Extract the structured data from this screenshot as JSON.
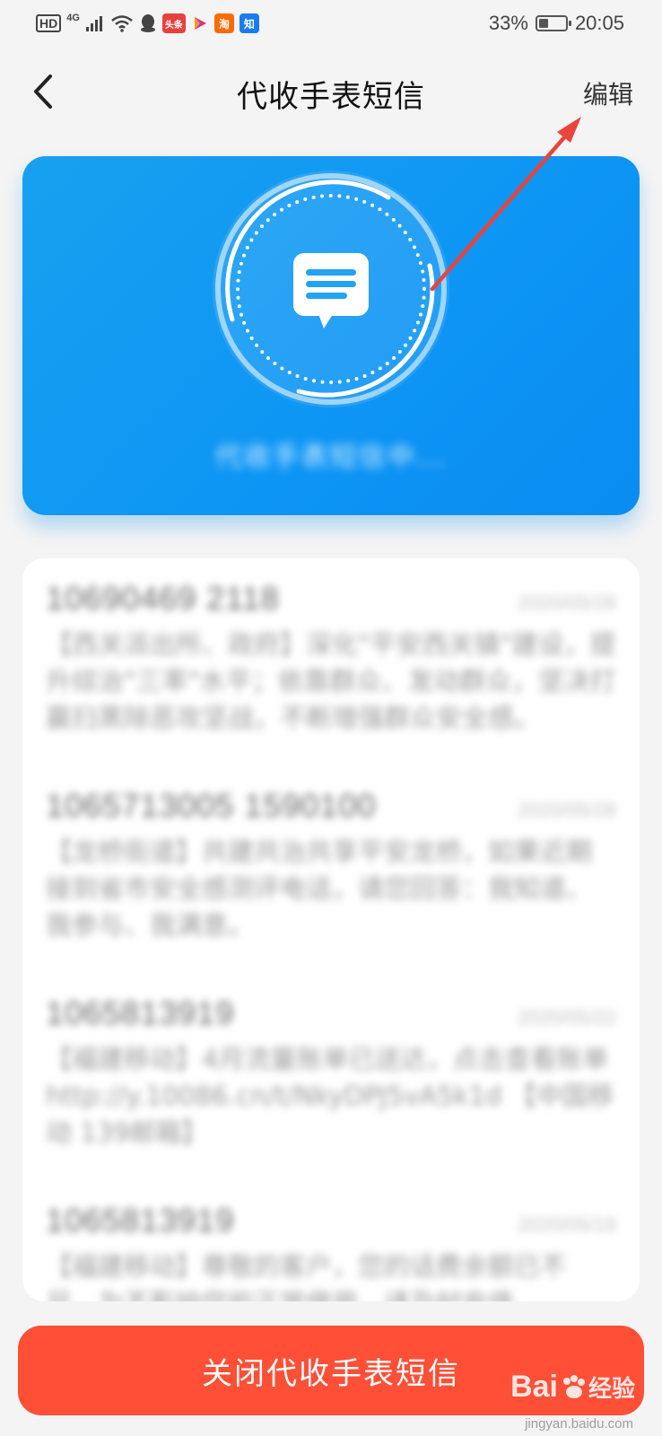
{
  "status_bar": {
    "hd": "HD",
    "network": "4G",
    "app_icons": [
      "头条",
      "淘",
      "知"
    ],
    "battery": "33%",
    "time": "20:05"
  },
  "nav": {
    "title": "代收手表短信",
    "edit_label": "编辑"
  },
  "hero": {
    "status_text": "代收手表短信中..."
  },
  "messages": [
    {
      "sender": "10690469 2118",
      "date": "2020/05/28",
      "body": "【西关派出所、政府】深化\"平安西关镇\"建设，提升综治\"三率\"水平；依靠群众、发动群众，坚决打赢扫黑除恶攻坚战，不断增强群众安全感。"
    },
    {
      "sender": "1065713005 1590100",
      "date": "2020/05/28",
      "body": "【龙桥街道】共建共治共享平安龙桥，如果近期接到省市安全感测评电话，请您回答：我知道、我参与、我满意。"
    },
    {
      "sender": "1065813919",
      "date": "2020/05/22",
      "body": "【福建移动】4月流量账单已送达，点击查看账单 http://y.10086.cn/t/NkyDPJ5vA5k1d 【中国移动 139邮箱】"
    },
    {
      "sender": "1065813919",
      "date": "2020/05/19",
      "body": "【福建移动】尊敬的客户，您的话费余额已不足，为不影响您的正常使用，请及时充值。"
    }
  ],
  "close_button_label": "关闭代收手表短信",
  "watermark": {
    "brand": "Bai",
    "brand_cn": "经验",
    "sub": "jingyan.baidu.com"
  },
  "colors": {
    "hero_blue": "#0d95f5",
    "close_red": "#ff4f37",
    "annotation_red": "#e8453c"
  }
}
